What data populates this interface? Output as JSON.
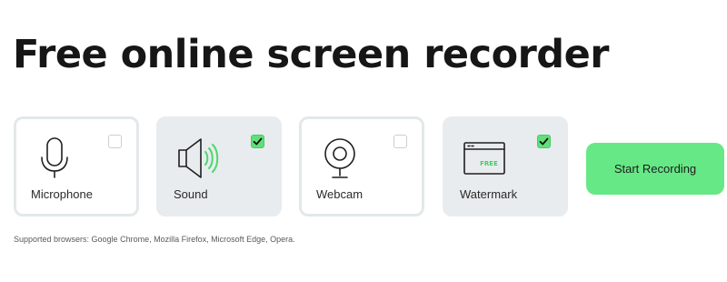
{
  "title": "Free online screen recorder",
  "options": [
    {
      "id": "microphone",
      "label": "Microphone",
      "checked": false,
      "icon": "microphone-icon"
    },
    {
      "id": "sound",
      "label": "Sound",
      "checked": true,
      "icon": "speaker-icon"
    },
    {
      "id": "webcam",
      "label": "Webcam",
      "checked": false,
      "icon": "webcam-icon"
    },
    {
      "id": "watermark",
      "label": "Watermark",
      "checked": true,
      "icon": "watermark-icon",
      "icon_text": "FREE"
    }
  ],
  "start_button": {
    "label": "Start Recording"
  },
  "supported_browsers": "Supported browsers: Google Chrome, Mozilla Firefox, Microsoft Edge, Opera.",
  "colors": {
    "accent_green": "#66e886",
    "check_green": "#5fe07a",
    "card_checked_bg": "#e8ecee",
    "card_border": "#e3e8ea"
  }
}
